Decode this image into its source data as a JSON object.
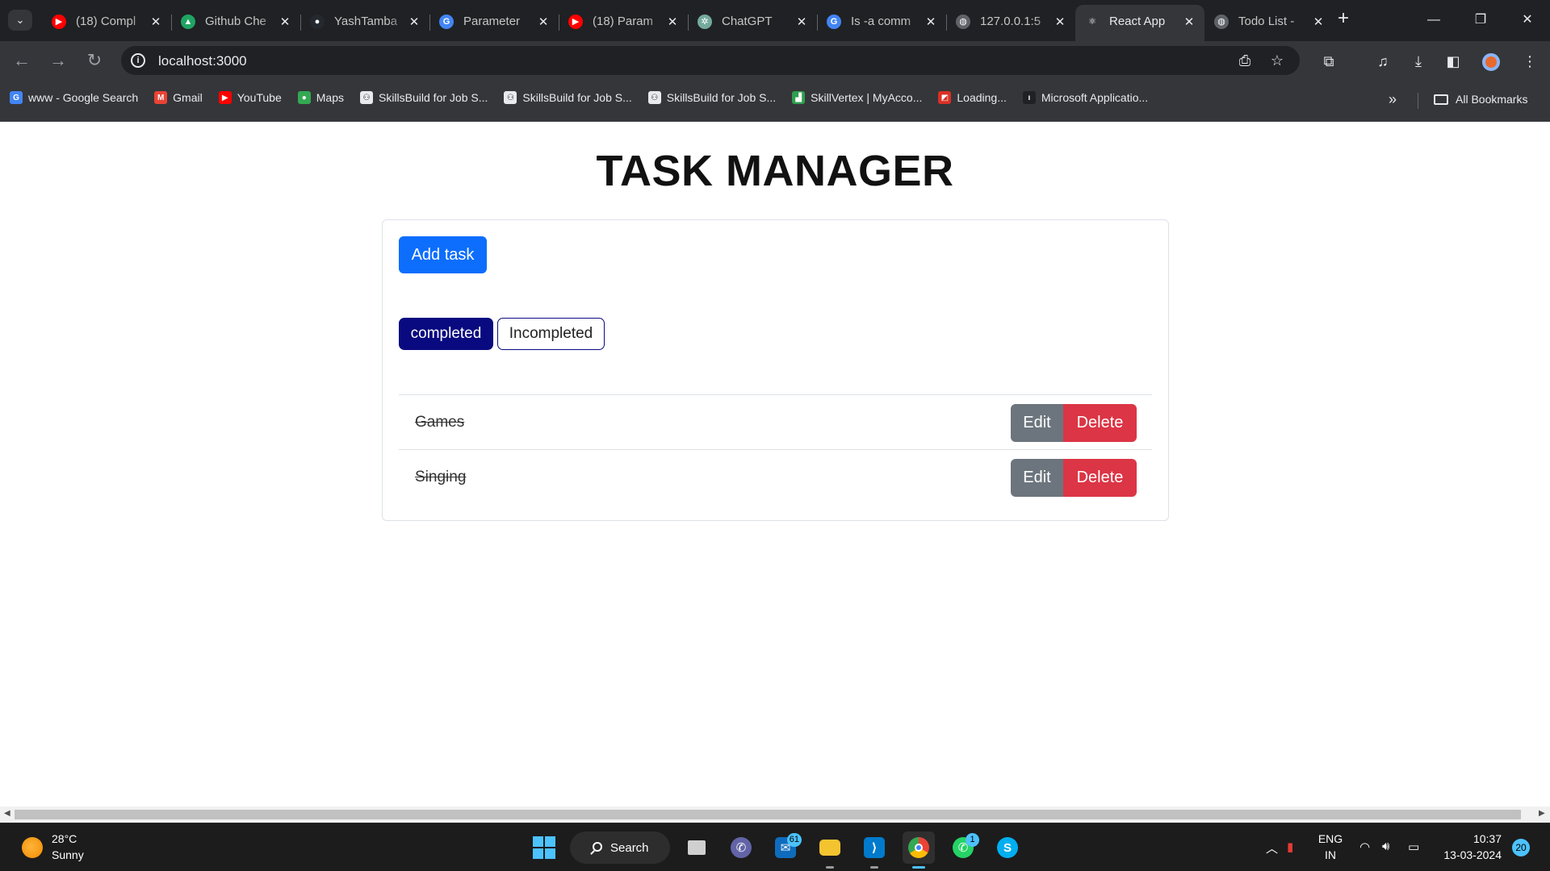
{
  "browser": {
    "tabs": [
      {
        "title": "(18) Compl",
        "icon": "youtube-icon",
        "color": "#ff0000",
        "glyph": "▶",
        "active": false
      },
      {
        "title": "Github Che",
        "icon": "google-drive-icon",
        "color": "#1fa463",
        "glyph": "▲",
        "active": false
      },
      {
        "title": "YashTamba",
        "icon": "github-icon",
        "color": "#24292f",
        "glyph": "●",
        "active": false
      },
      {
        "title": "Parameter",
        "icon": "google-icon",
        "color": "#4285f4",
        "glyph": "G",
        "active": false
      },
      {
        "title": "(18) Param",
        "icon": "youtube-icon",
        "color": "#ff0000",
        "glyph": "▶",
        "active": false
      },
      {
        "title": "ChatGPT",
        "icon": "chatgpt-icon",
        "color": "#74aa9c",
        "glyph": "✲",
        "active": false
      },
      {
        "title": "Is -a comm",
        "icon": "google-icon",
        "color": "#4285f4",
        "glyph": "G",
        "active": false
      },
      {
        "title": "127.0.0.1:5",
        "icon": "globe-icon",
        "color": "#5f6368",
        "glyph": "◍",
        "active": false
      },
      {
        "title": "React App",
        "icon": "react-icon",
        "color": "#35363a",
        "glyph": "⚛",
        "active": true
      },
      {
        "title": "Todo List -",
        "icon": "globe-icon",
        "color": "#5f6368",
        "glyph": "◍",
        "active": false
      }
    ],
    "address": "localhost:3000",
    "bookmarks": [
      {
        "label": "www - Google Search",
        "icon": "google-icon",
        "color": "#4285f4",
        "glyph": "G"
      },
      {
        "label": "Gmail",
        "icon": "gmail-icon",
        "color": "#ea4335",
        "glyph": "M"
      },
      {
        "label": "YouTube",
        "icon": "youtube-icon",
        "color": "#ff0000",
        "glyph": "▶"
      },
      {
        "label": "Maps",
        "icon": "maps-icon",
        "color": "#34a853",
        "glyph": "●"
      },
      {
        "label": "SkillsBuild for Job S...",
        "icon": "skillsbuild-icon",
        "color": "#e8eaed",
        "glyph": "⚇"
      },
      {
        "label": "SkillsBuild for Job S...",
        "icon": "skillsbuild-icon",
        "color": "#e8eaed",
        "glyph": "⚇"
      },
      {
        "label": "SkillsBuild for Job S...",
        "icon": "skillsbuild-icon",
        "color": "#e8eaed",
        "glyph": "⚇"
      },
      {
        "label": "SkillVertex | MyAcco...",
        "icon": "skillvertex-icon",
        "color": "#2e9e4f",
        "glyph": "▟"
      },
      {
        "label": "Loading...",
        "icon": "loading-icon",
        "color": "#d93025",
        "glyph": "◩"
      },
      {
        "label": "Microsoft Applicatio...",
        "icon": "microsoft-icon",
        "color": "#202124",
        "glyph": "ı"
      }
    ],
    "all_bookmarks": "All Bookmarks"
  },
  "app": {
    "title": "TASK MANAGER",
    "add_task_label": "Add task",
    "filters": {
      "completed": "completed",
      "incompleted": "Incompleted"
    },
    "tasks": [
      {
        "name": "Games",
        "edit": "Edit",
        "delete": "Delete"
      },
      {
        "name": "Singing",
        "edit": "Edit",
        "delete": "Delete"
      }
    ]
  },
  "taskbar": {
    "weather": {
      "temp": "28°C",
      "condition": "Sunny"
    },
    "search_label": "Search",
    "badges": {
      "mail": "61",
      "whatsapp": "1"
    },
    "language": {
      "line1": "ENG",
      "line2": "IN"
    },
    "time": "10:37",
    "date": "13-03-2024",
    "notifications": "20"
  },
  "colors": {
    "primary": "#0d6efd",
    "completed_navy": "#0a0a80",
    "edit_gray": "#6c757d",
    "delete_red": "#dc3545"
  }
}
